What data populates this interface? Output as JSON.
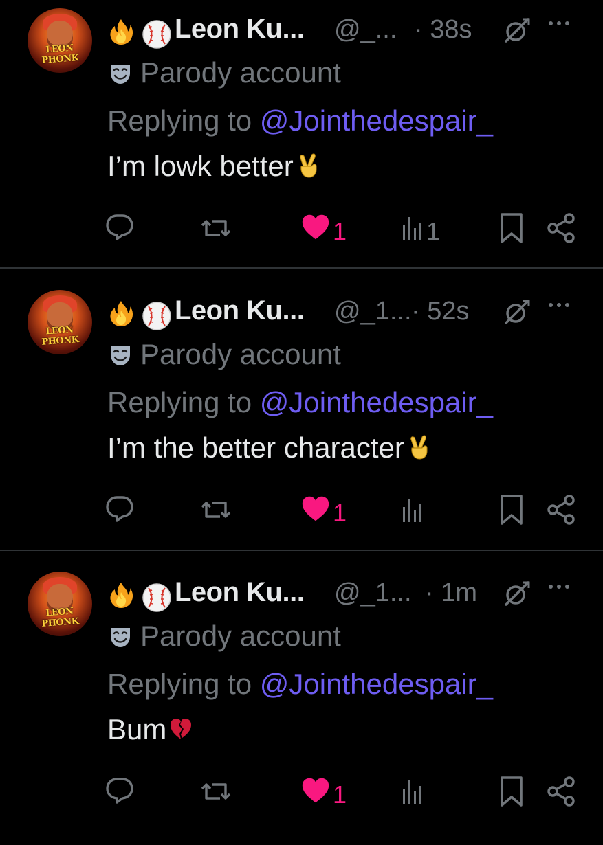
{
  "colors": {
    "background": "#000000",
    "text_primary": "#e7e9ea",
    "text_secondary": "#71767b",
    "mention": "#6e5df2",
    "like_active": "#f91880",
    "divider": "#2f3336"
  },
  "posts": [
    {
      "avatar_text": "LEON PHONK",
      "name": "Leon Ku...",
      "handle": "@_...",
      "time": "· 38s",
      "parody_label": "Parody account",
      "reply_prefix": "Replying to",
      "reply_mention": "@Jointhedespair_",
      "text": "I’m lowk better",
      "emoji": "victory-hand-emoji",
      "like_count": "1",
      "view_count": "1"
    },
    {
      "avatar_text": "LEON PHONK",
      "name": "Leon Ku...",
      "handle": "@_1...",
      "time": "· 52s",
      "parody_label": "Parody account",
      "reply_prefix": "Replying to",
      "reply_mention": "@Jointhedespair_",
      "text": "I’m the better character",
      "emoji": "victory-hand-emoji",
      "like_count": "1",
      "view_count": ""
    },
    {
      "avatar_text": "LEON PHONK",
      "name": "Leon Ku...",
      "handle": "@_1...",
      "time": "· 1m",
      "parody_label": "Parody account",
      "reply_prefix": "Replying to",
      "reply_mention": "@Jointhedespair_",
      "text": "Bum",
      "emoji": "broken-heart-emoji",
      "like_count": "1",
      "view_count": ""
    }
  ]
}
